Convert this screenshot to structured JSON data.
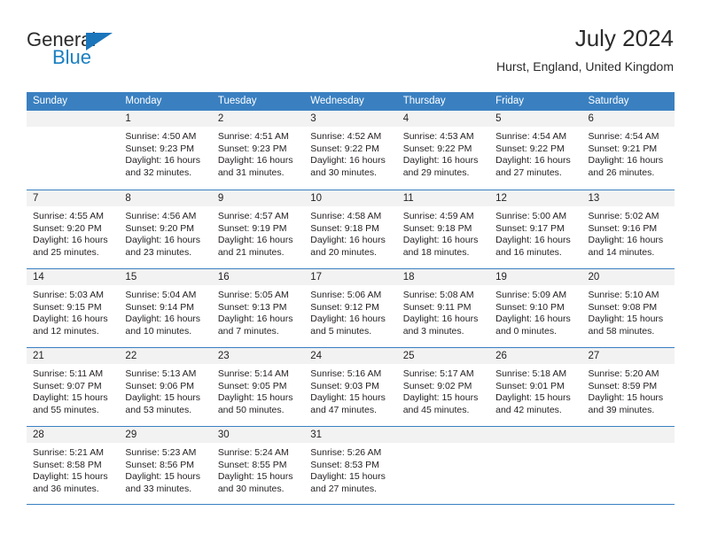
{
  "logo": {
    "word_top": "General",
    "word_bottom": "Blue",
    "accent_color": "#1b75bb"
  },
  "header": {
    "title": "July 2024",
    "subtitle": "Hurst, England, United Kingdom"
  },
  "calendar": {
    "header_color": "#3a80c1",
    "weekdays": [
      "Sunday",
      "Monday",
      "Tuesday",
      "Wednesday",
      "Thursday",
      "Friday",
      "Saturday"
    ],
    "weeks": [
      [
        {
          "day": "",
          "l1": "",
          "l2": "",
          "l3": "",
          "l4": ""
        },
        {
          "day": "1",
          "l1": "Sunrise: 4:50 AM",
          "l2": "Sunset: 9:23 PM",
          "l3": "Daylight: 16 hours",
          "l4": "and 32 minutes."
        },
        {
          "day": "2",
          "l1": "Sunrise: 4:51 AM",
          "l2": "Sunset: 9:23 PM",
          "l3": "Daylight: 16 hours",
          "l4": "and 31 minutes."
        },
        {
          "day": "3",
          "l1": "Sunrise: 4:52 AM",
          "l2": "Sunset: 9:22 PM",
          "l3": "Daylight: 16 hours",
          "l4": "and 30 minutes."
        },
        {
          "day": "4",
          "l1": "Sunrise: 4:53 AM",
          "l2": "Sunset: 9:22 PM",
          "l3": "Daylight: 16 hours",
          "l4": "and 29 minutes."
        },
        {
          "day": "5",
          "l1": "Sunrise: 4:54 AM",
          "l2": "Sunset: 9:22 PM",
          "l3": "Daylight: 16 hours",
          "l4": "and 27 minutes."
        },
        {
          "day": "6",
          "l1": "Sunrise: 4:54 AM",
          "l2": "Sunset: 9:21 PM",
          "l3": "Daylight: 16 hours",
          "l4": "and 26 minutes."
        }
      ],
      [
        {
          "day": "7",
          "l1": "Sunrise: 4:55 AM",
          "l2": "Sunset: 9:20 PM",
          "l3": "Daylight: 16 hours",
          "l4": "and 25 minutes."
        },
        {
          "day": "8",
          "l1": "Sunrise: 4:56 AM",
          "l2": "Sunset: 9:20 PM",
          "l3": "Daylight: 16 hours",
          "l4": "and 23 minutes."
        },
        {
          "day": "9",
          "l1": "Sunrise: 4:57 AM",
          "l2": "Sunset: 9:19 PM",
          "l3": "Daylight: 16 hours",
          "l4": "and 21 minutes."
        },
        {
          "day": "10",
          "l1": "Sunrise: 4:58 AM",
          "l2": "Sunset: 9:18 PM",
          "l3": "Daylight: 16 hours",
          "l4": "and 20 minutes."
        },
        {
          "day": "11",
          "l1": "Sunrise: 4:59 AM",
          "l2": "Sunset: 9:18 PM",
          "l3": "Daylight: 16 hours",
          "l4": "and 18 minutes."
        },
        {
          "day": "12",
          "l1": "Sunrise: 5:00 AM",
          "l2": "Sunset: 9:17 PM",
          "l3": "Daylight: 16 hours",
          "l4": "and 16 minutes."
        },
        {
          "day": "13",
          "l1": "Sunrise: 5:02 AM",
          "l2": "Sunset: 9:16 PM",
          "l3": "Daylight: 16 hours",
          "l4": "and 14 minutes."
        }
      ],
      [
        {
          "day": "14",
          "l1": "Sunrise: 5:03 AM",
          "l2": "Sunset: 9:15 PM",
          "l3": "Daylight: 16 hours",
          "l4": "and 12 minutes."
        },
        {
          "day": "15",
          "l1": "Sunrise: 5:04 AM",
          "l2": "Sunset: 9:14 PM",
          "l3": "Daylight: 16 hours",
          "l4": "and 10 minutes."
        },
        {
          "day": "16",
          "l1": "Sunrise: 5:05 AM",
          "l2": "Sunset: 9:13 PM",
          "l3": "Daylight: 16 hours",
          "l4": "and 7 minutes."
        },
        {
          "day": "17",
          "l1": "Sunrise: 5:06 AM",
          "l2": "Sunset: 9:12 PM",
          "l3": "Daylight: 16 hours",
          "l4": "and 5 minutes."
        },
        {
          "day": "18",
          "l1": "Sunrise: 5:08 AM",
          "l2": "Sunset: 9:11 PM",
          "l3": "Daylight: 16 hours",
          "l4": "and 3 minutes."
        },
        {
          "day": "19",
          "l1": "Sunrise: 5:09 AM",
          "l2": "Sunset: 9:10 PM",
          "l3": "Daylight: 16 hours",
          "l4": "and 0 minutes."
        },
        {
          "day": "20",
          "l1": "Sunrise: 5:10 AM",
          "l2": "Sunset: 9:08 PM",
          "l3": "Daylight: 15 hours",
          "l4": "and 58 minutes."
        }
      ],
      [
        {
          "day": "21",
          "l1": "Sunrise: 5:11 AM",
          "l2": "Sunset: 9:07 PM",
          "l3": "Daylight: 15 hours",
          "l4": "and 55 minutes."
        },
        {
          "day": "22",
          "l1": "Sunrise: 5:13 AM",
          "l2": "Sunset: 9:06 PM",
          "l3": "Daylight: 15 hours",
          "l4": "and 53 minutes."
        },
        {
          "day": "23",
          "l1": "Sunrise: 5:14 AM",
          "l2": "Sunset: 9:05 PM",
          "l3": "Daylight: 15 hours",
          "l4": "and 50 minutes."
        },
        {
          "day": "24",
          "l1": "Sunrise: 5:16 AM",
          "l2": "Sunset: 9:03 PM",
          "l3": "Daylight: 15 hours",
          "l4": "and 47 minutes."
        },
        {
          "day": "25",
          "l1": "Sunrise: 5:17 AM",
          "l2": "Sunset: 9:02 PM",
          "l3": "Daylight: 15 hours",
          "l4": "and 45 minutes."
        },
        {
          "day": "26",
          "l1": "Sunrise: 5:18 AM",
          "l2": "Sunset: 9:01 PM",
          "l3": "Daylight: 15 hours",
          "l4": "and 42 minutes."
        },
        {
          "day": "27",
          "l1": "Sunrise: 5:20 AM",
          "l2": "Sunset: 8:59 PM",
          "l3": "Daylight: 15 hours",
          "l4": "and 39 minutes."
        }
      ],
      [
        {
          "day": "28",
          "l1": "Sunrise: 5:21 AM",
          "l2": "Sunset: 8:58 PM",
          "l3": "Daylight: 15 hours",
          "l4": "and 36 minutes."
        },
        {
          "day": "29",
          "l1": "Sunrise: 5:23 AM",
          "l2": "Sunset: 8:56 PM",
          "l3": "Daylight: 15 hours",
          "l4": "and 33 minutes."
        },
        {
          "day": "30",
          "l1": "Sunrise: 5:24 AM",
          "l2": "Sunset: 8:55 PM",
          "l3": "Daylight: 15 hours",
          "l4": "and 30 minutes."
        },
        {
          "day": "31",
          "l1": "Sunrise: 5:26 AM",
          "l2": "Sunset: 8:53 PM",
          "l3": "Daylight: 15 hours",
          "l4": "and 27 minutes."
        },
        {
          "day": "",
          "l1": "",
          "l2": "",
          "l3": "",
          "l4": ""
        },
        {
          "day": "",
          "l1": "",
          "l2": "",
          "l3": "",
          "l4": ""
        },
        {
          "day": "",
          "l1": "",
          "l2": "",
          "l3": "",
          "l4": ""
        }
      ]
    ]
  }
}
